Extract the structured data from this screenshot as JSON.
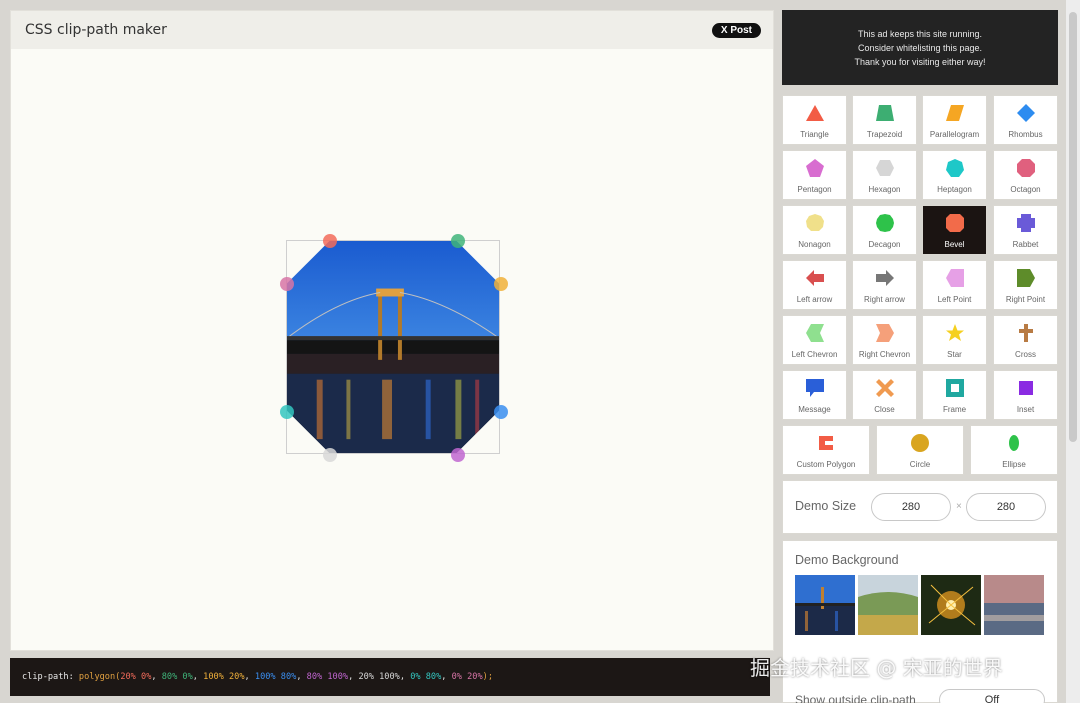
{
  "header": {
    "title": "CSS clip-path maker",
    "post_label": "X Post"
  },
  "code": {
    "property": "clip-path: ",
    "func_open": "polygon(",
    "points": [
      {
        "text": "20% 0%",
        "color": "#f26b5b"
      },
      {
        "text": "80% 0%",
        "color": "#3fb47a"
      },
      {
        "text": "100% 20%",
        "color": "#f0b03a"
      },
      {
        "text": "100% 80%",
        "color": "#3a8ef0"
      },
      {
        "text": "80% 100%",
        "color": "#c066d0"
      },
      {
        "text": "20% 100%",
        "color": "#d8d8d8"
      },
      {
        "text": "0% 80%",
        "color": "#33c6c0"
      },
      {
        "text": "0% 20%",
        "color": "#d774a6"
      }
    ],
    "func_close": ");"
  },
  "ad": {
    "lines": [
      "This ad keeps this site running.",
      "Consider whitelisting this page.",
      "Thank you for visiting either way!"
    ]
  },
  "shapes": [
    {
      "label": "Triangle",
      "icon": "triangle-icon",
      "color": "#f25c45"
    },
    {
      "label": "Trapezoid",
      "icon": "trapezoid-icon",
      "color": "#3dae72"
    },
    {
      "label": "Parallelogram",
      "icon": "parallelogram-icon",
      "color": "#f5a623"
    },
    {
      "label": "Rhombus",
      "icon": "rhombus-icon",
      "color": "#2d8cf0"
    },
    {
      "label": "Pentagon",
      "icon": "pentagon-icon",
      "color": "#d86dd0"
    },
    {
      "label": "Hexagon",
      "icon": "hexagon-icon",
      "color": "#d6d6d6"
    },
    {
      "label": "Heptagon",
      "icon": "heptagon-icon",
      "color": "#1ec8c8"
    },
    {
      "label": "Octagon",
      "icon": "octagon-icon",
      "color": "#e0607e"
    },
    {
      "label": "Nonagon",
      "icon": "nonagon-icon",
      "color": "#f0e08a"
    },
    {
      "label": "Decagon",
      "icon": "decagon-icon",
      "color": "#2ec24a"
    },
    {
      "label": "Bevel",
      "icon": "bevel-icon",
      "color": "#f26b4a"
    },
    {
      "label": "Rabbet",
      "icon": "rabbet-icon",
      "color": "#6a5ad8"
    },
    {
      "label": "Left arrow",
      "icon": "left-arrow-icon",
      "color": "#d94f4f"
    },
    {
      "label": "Right arrow",
      "icon": "right-arrow-icon",
      "color": "#777777"
    },
    {
      "label": "Left Point",
      "icon": "left-point-icon",
      "color": "#e6a0e6"
    },
    {
      "label": "Right Point",
      "icon": "right-point-icon",
      "color": "#5e8c2a"
    },
    {
      "label": "Left Chevron",
      "icon": "left-chevron-icon",
      "color": "#8fe08f"
    },
    {
      "label": "Right Chevron",
      "icon": "right-chevron-icon",
      "color": "#f5a07a"
    },
    {
      "label": "Star",
      "icon": "star-icon",
      "color": "#f5d020"
    },
    {
      "label": "Cross",
      "icon": "cross-icon",
      "color": "#b87b44"
    },
    {
      "label": "Message",
      "icon": "message-icon",
      "color": "#2a5fd8"
    },
    {
      "label": "Close",
      "icon": "close-icon",
      "color": "#f09a50"
    },
    {
      "label": "Frame",
      "icon": "frame-icon",
      "color": "#20a8a0"
    },
    {
      "label": "Inset",
      "icon": "inset-icon",
      "color": "#8a2be2"
    }
  ],
  "shapes_bottom": [
    {
      "label": "Custom Polygon",
      "icon": "custom-polygon-icon",
      "color": "#f25c45"
    },
    {
      "label": "Circle",
      "icon": "circle-icon",
      "color": "#d9a520"
    },
    {
      "label": "Ellipse",
      "icon": "ellipse-icon",
      "color": "#2ec24a"
    }
  ],
  "active_shape": "Bevel",
  "demo_size": {
    "label": "Demo Size",
    "width": "280",
    "height": "280",
    "separator": "×"
  },
  "demo_background": {
    "label": "Demo Background"
  },
  "outside": {
    "label": "Show outside clip-path",
    "value": "Off"
  },
  "watermark": "掘金技术社区 @ 宋亚的世界"
}
